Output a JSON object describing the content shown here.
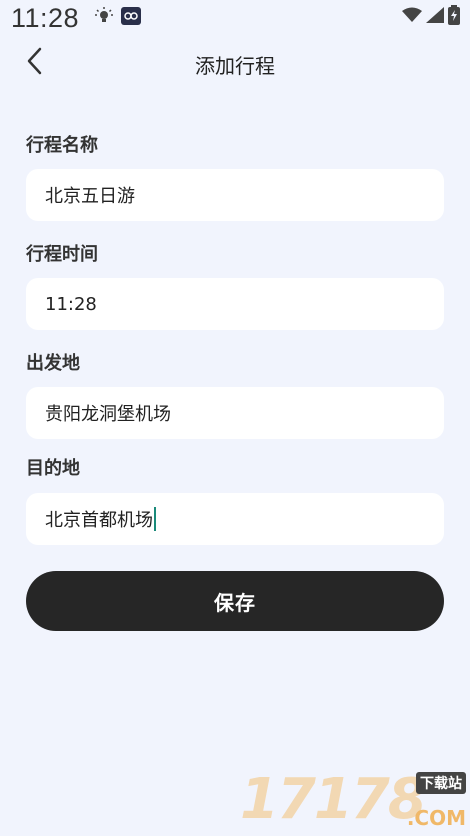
{
  "status_bar": {
    "time": "11:28",
    "icons": [
      "bulb-icon",
      "app-notification-icon",
      "wifi-icon",
      "signal-icon",
      "battery-icon"
    ]
  },
  "header": {
    "title": "添加行程",
    "back_icon": "chevron-left-icon"
  },
  "form": {
    "name_label": "行程名称",
    "name_value": "北京五日游",
    "time_label": "行程时间",
    "time_value": "11:28",
    "origin_label": "出发地",
    "origin_value": "贵阳龙洞堡机场",
    "destination_label": "目的地",
    "destination_value": "北京首都机场"
  },
  "actions": {
    "save_label": "保存"
  },
  "watermark": {
    "digits": "17178",
    "badge": "下载站",
    "suffix": ".COM"
  },
  "colors": {
    "background": "#f1f4fd",
    "field_background": "#ffffff",
    "button_background": "#262626",
    "cursor": "#1a8a7a"
  }
}
